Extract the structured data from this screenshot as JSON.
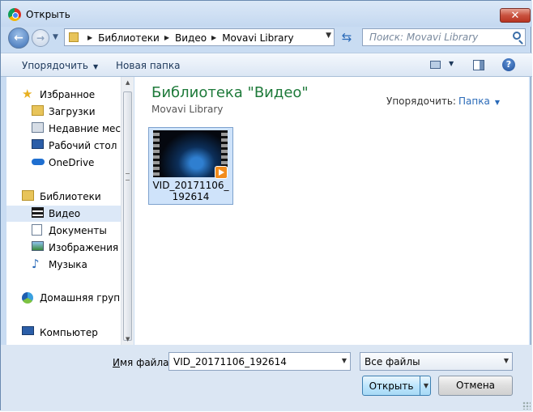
{
  "window": {
    "title": "Открыть",
    "close_label": "✕",
    "app_icon": "chrome-icon"
  },
  "address": {
    "crumbs": [
      "Библиотеки",
      "Видео",
      "Movavi Library"
    ]
  },
  "search": {
    "placeholder": "Поиск: Movavi Library"
  },
  "toolbar": {
    "organize_label": "Упорядочить",
    "new_folder_label": "Новая папка"
  },
  "sidebar": {
    "favorites": {
      "label": "Избранное",
      "icon": "star-icon"
    },
    "favorite_items": [
      {
        "label": "Загрузки",
        "icon": "downloads-icon"
      },
      {
        "label": "Недавние места",
        "icon": "recent-places-icon"
      },
      {
        "label": "Рабочий стол",
        "icon": "desktop-icon"
      },
      {
        "label": "OneDrive",
        "icon": "onedrive-icon"
      }
    ],
    "libraries": {
      "label": "Библиотеки",
      "icon": "libraries-icon"
    },
    "library_items": [
      {
        "label": "Видео",
        "icon": "video-icon",
        "selected": true
      },
      {
        "label": "Документы",
        "icon": "documents-icon"
      },
      {
        "label": "Изображения",
        "icon": "pictures-icon"
      },
      {
        "label": "Музыка",
        "icon": "music-icon"
      }
    ],
    "homegroup": {
      "label": "Домашняя группа",
      "icon": "homegroup-icon"
    },
    "computer": {
      "label": "Компьютер",
      "icon": "computer-icon"
    }
  },
  "main": {
    "title": "Библиотека \"Видео\"",
    "subtitle": "Movavi Library",
    "arrange_label": "Упорядочить:",
    "arrange_value": "Папка",
    "files": [
      {
        "name": "VID_20171106_192614",
        "type": "video"
      }
    ]
  },
  "bottom": {
    "filename_label_u": "И",
    "filename_label_rest": "мя файла:",
    "filename_value": "VID_20171106_192614",
    "filter_value": "Все файлы",
    "open_label": "Открыть",
    "cancel_label": "Отмена"
  },
  "colors": {
    "title_green": "#1e7a3a",
    "link_blue": "#2a6ab8",
    "selection": "#cfe3fa",
    "chrome": "#c9dcf2"
  }
}
